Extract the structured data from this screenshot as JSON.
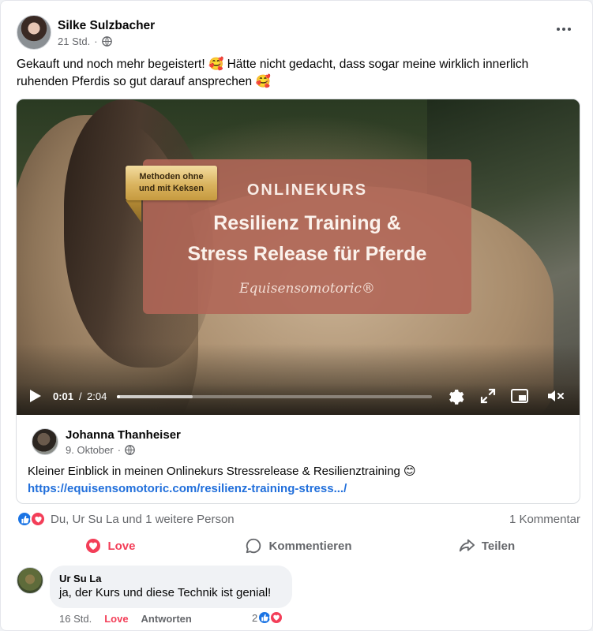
{
  "post": {
    "author": "Silke Sulzbacher",
    "time": "21 Std.",
    "meta_dot": "·",
    "text": "Gekauft und noch mehr begeistert! 🥰 Hätte nicht gedacht, dass sogar meine wirklich innerlich ruhenden Pferdis so gut darauf ansprechen 🥰",
    "more_label": "•••"
  },
  "video": {
    "tag_line1": "Methoden ohne",
    "tag_line2": "und mit Keksen",
    "kicker": "ONLINEKURS",
    "title_line1": "Resilienz Training &",
    "title_line2": "Stress Release für Pferde",
    "brand": "Equisensomotoric®",
    "time_current": "0:01",
    "time_sep": "/",
    "time_total": "2:04",
    "progress": 0.01,
    "buffered": 0.24
  },
  "shared": {
    "author": "Johanna Thanheiser",
    "date": "9. Oktober",
    "meta_dot": "·",
    "text": "Kleiner Einblick in meinen Onlinekurs Stressrelease & Resilienztraining 😊",
    "link": "https://equisensomotoric.com/resilienz-training-stress.../"
  },
  "reactions": {
    "names": "Du, Ur Su La und 1 weitere Person",
    "comment_count": "1 Kommentar"
  },
  "actions": {
    "love": "Love",
    "comment": "Kommentieren",
    "share": "Teilen"
  },
  "comment": {
    "author": "Ur Su La",
    "text": "ja, der Kurs und diese Technik ist genial!",
    "time": "16 Std.",
    "love": "Love",
    "reply": "Antworten",
    "reaction_count": "2"
  },
  "colors": {
    "link": "#216fdb",
    "love": "#f33e58",
    "like": "#1b74e4",
    "promo": "#b06556"
  }
}
